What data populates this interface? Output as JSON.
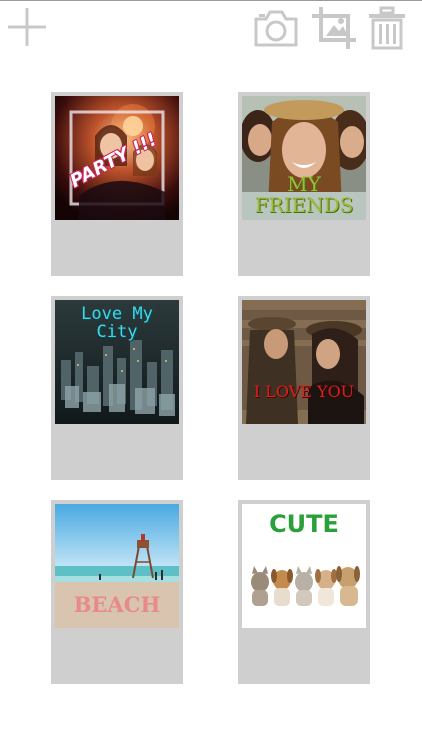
{
  "toolbar": {
    "add_icon": "plus-icon",
    "camera_icon": "camera-icon",
    "crop_icon": "crop-icon",
    "delete_icon": "trash-icon",
    "icon_color": "#c8c8c8"
  },
  "gallery": {
    "card_color": "#cfcfcf",
    "items": [
      {
        "caption": "PARTY !!!",
        "caption_color": "#ffffff",
        "scene": "party-selfie"
      },
      {
        "caption": "MY FRIENDS",
        "caption_color": "#9bbf3a",
        "scene": "friends-selfie"
      },
      {
        "caption": "Love My\nCity",
        "caption_color": "#3fd8e8",
        "scene": "city-aerial"
      },
      {
        "caption": "I LOVE YOU",
        "caption_color": "#d8201c",
        "scene": "couple"
      },
      {
        "caption": "BEACH",
        "caption_color": "#e8898a",
        "scene": "beach-lifeguard-tower"
      },
      {
        "caption": "CUTE",
        "caption_color": "#2aa03a",
        "scene": "kittens-and-puppies"
      }
    ]
  }
}
